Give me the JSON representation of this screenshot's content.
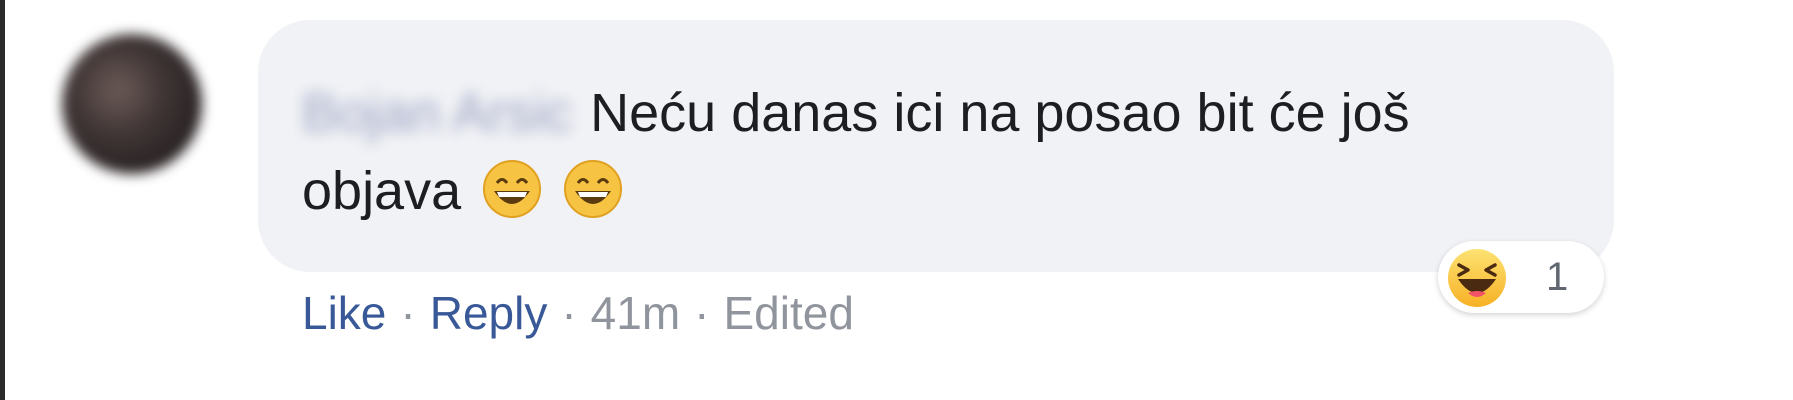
{
  "comment": {
    "author_name": "Bojan Arsic",
    "text": "Neću danas ici na posao bit će još objava",
    "emojis": [
      "grinning-face-emoji",
      "grinning-face-emoji"
    ]
  },
  "reaction": {
    "icon": "laughing-face-icon",
    "count": "1"
  },
  "actions": {
    "like_label": "Like",
    "reply_label": "Reply",
    "separator": "·",
    "timestamp": "41m",
    "edited_label": "Edited"
  },
  "colors": {
    "bubble_bg": "#f1f2f6",
    "link_blue": "#385898",
    "muted_gray": "#90949c",
    "text": "#1c1e21"
  }
}
